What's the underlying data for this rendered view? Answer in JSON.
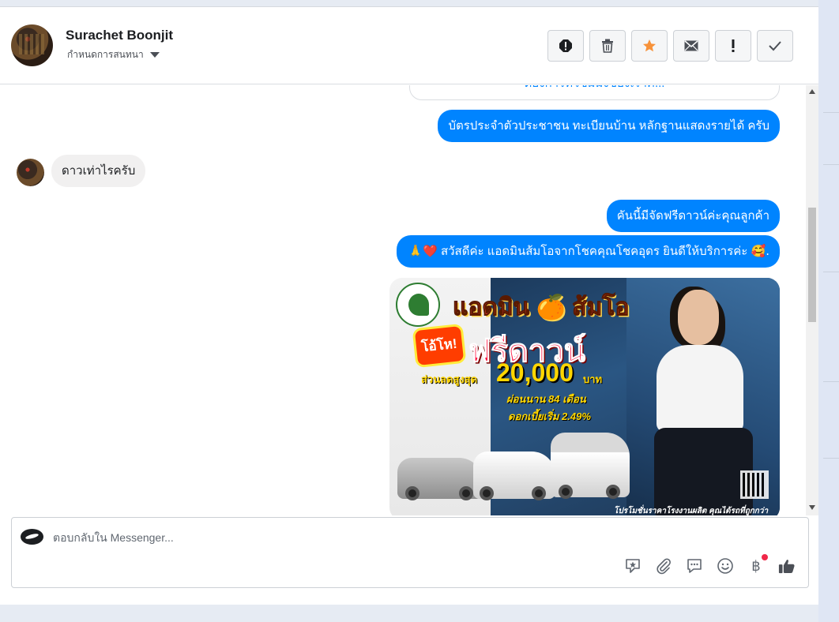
{
  "header": {
    "contact_name": "Surachet Boonjit",
    "subtitle": "กำหนดการสนทนา"
  },
  "toolbar": {
    "buttons": [
      "alert-icon",
      "trash-icon",
      "star-icon",
      "envelope-icon",
      "exclamation-icon",
      "check-icon"
    ]
  },
  "messages": {
    "prev_partial": "ต้องการทีวีชมมิ่งของเราค...",
    "outgoing_1": "บัตรประจำตัวประชาชน ทะเบียนบ้าน หลักฐานแสดงรายได้ ครับ",
    "incoming_1": "ดาวเท่าไรครับ",
    "outgoing_2": "คันนี้มีจัดฟรีดาวน์ค่ะคุณลูกค้า",
    "outgoing_3_emoji_start": "🙏❤️",
    "outgoing_3": " สวัสดีค่ะ แอดมินส้มโอจากโชคคุณโชคอุดร ยินดีให้บริการค่ะ ",
    "outgoing_3_emoji_end": "🥰."
  },
  "promo": {
    "title": "แอดมิน 🍊 ส้มโอ",
    "burst": "โอ้โห!",
    "headline": "ฟรีดาวน์",
    "discount_label": "ส่วนลดสูงสุด",
    "discount_value": "20,000",
    "discount_unit": "บาท",
    "installment": "ผ่อนนาน 84 เดือน",
    "interest": "ดอกเบี้ยเริ่ม 2.49%",
    "footer": "โปรโมชั่นราคาโรงงานผลิต คุณได้รถที่ถูกกว่า"
  },
  "composer": {
    "placeholder": "ตอบกลับใน Messenger...",
    "value": "",
    "icons": [
      "sticker-icon",
      "attach-icon",
      "saved-reply-icon",
      "emoji-icon",
      "baht-icon",
      "like-icon"
    ],
    "baht_symbol": "฿"
  },
  "colors": {
    "accent": "#0084ff",
    "incoming_bg": "#f1f0f0",
    "notification": "#f02849"
  }
}
